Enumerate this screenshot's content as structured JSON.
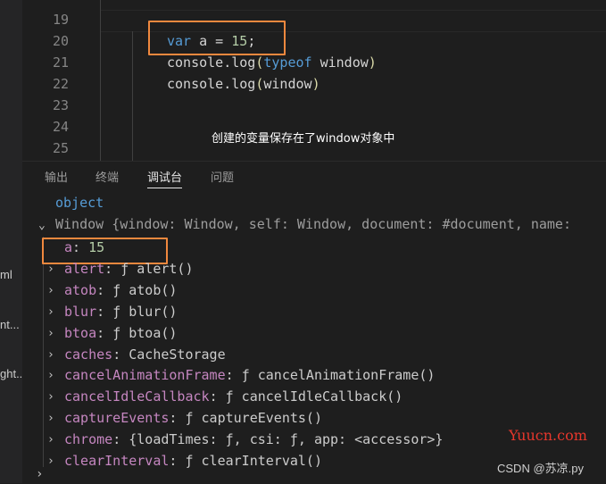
{
  "sidebar": {
    "fragments": [
      "ml",
      "nt...",
      "ght..."
    ]
  },
  "editor": {
    "line_numbers": [
      "19",
      "20",
      "21",
      "22",
      "23",
      "24",
      "25"
    ],
    "lines": {
      "l20": {
        "kw": "var",
        "rest_a": " a = ",
        "num": "15",
        "end": ";"
      },
      "l21": {
        "obj": "console",
        "dot": ".",
        "fn": "log",
        "open": "(",
        "kw": "typeof",
        "sp": " ",
        "arg": "window",
        "close": ")"
      },
      "l22": {
        "obj": "console",
        "dot": ".",
        "fn": "log",
        "open": "(",
        "arg": "window",
        "close": ")"
      }
    },
    "caption": "创建的变量保存在了window对象中"
  },
  "panel": {
    "tabs": [
      "输出",
      "终端",
      "调试台",
      "问题"
    ],
    "active_tab": "调试台",
    "output": {
      "typeof_result": "object",
      "window_summary": "Window {window: Window, self: Window, document: #document, name:",
      "props": [
        {
          "key": "a",
          "value": "15",
          "expandable": false
        },
        {
          "key": "alert",
          "value": "ƒ alert()",
          "expandable": true
        },
        {
          "key": "atob",
          "value": "ƒ atob()",
          "expandable": true
        },
        {
          "key": "blur",
          "value": "ƒ blur()",
          "expandable": true
        },
        {
          "key": "btoa",
          "value": "ƒ btoa()",
          "expandable": true
        },
        {
          "key": "caches",
          "value": "CacheStorage",
          "expandable": true
        },
        {
          "key": "cancelAnimationFrame",
          "value": "ƒ cancelAnimationFrame()",
          "expandable": true
        },
        {
          "key": "cancelIdleCallback",
          "value": "ƒ cancelIdleCallback()",
          "expandable": true
        },
        {
          "key": "captureEvents",
          "value": "ƒ captureEvents()",
          "expandable": true
        },
        {
          "key": "chrome",
          "value": "{loadTimes: ƒ, csi: ƒ, app: <accessor>}",
          "expandable": true
        },
        {
          "key": "clearInterval",
          "value": "ƒ clearInterval()",
          "expandable": true
        }
      ]
    }
  },
  "watermarks": {
    "yuucn": "Yuucn.com",
    "csdn": "CSDN @苏凉.py"
  },
  "colors": {
    "highlight_box": "#f0883e",
    "keyword": "#569cd6",
    "property": "#c586c0",
    "number": "#b5cea8"
  }
}
